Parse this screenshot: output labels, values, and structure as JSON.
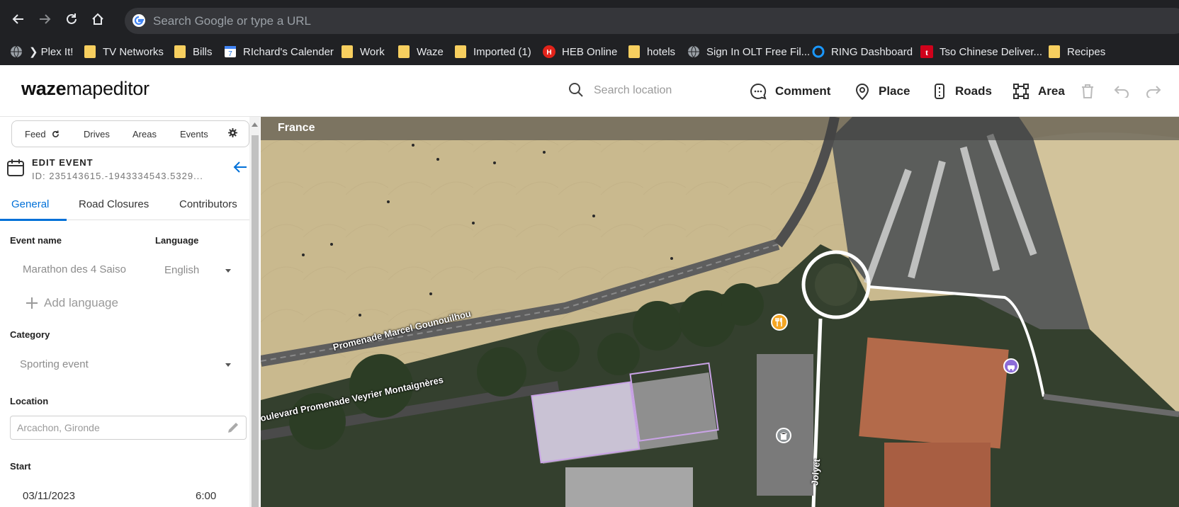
{
  "browser": {
    "omnibox_placeholder": "Search Google or type a URL",
    "bookmarks": [
      {
        "label": "Plex It!",
        "prefix": "❯",
        "icon": "globe-icon"
      },
      {
        "label": "TV Networks",
        "icon": "folder-icon"
      },
      {
        "label": "Bills",
        "icon": "folder-icon"
      },
      {
        "label": "RIchard's Calender",
        "icon": "calendar-icon"
      },
      {
        "label": "Work",
        "icon": "folder-icon"
      },
      {
        "label": "Waze",
        "icon": "folder-icon"
      },
      {
        "label": "Imported (1)",
        "icon": "folder-icon"
      },
      {
        "label": "HEB Online",
        "icon": "heb-icon"
      },
      {
        "label": "hotels",
        "icon": "folder-icon"
      },
      {
        "label": "Sign In OLT Free Fil...",
        "icon": "globe-icon"
      },
      {
        "label": "RING Dashboard",
        "icon": "ring-icon"
      },
      {
        "label": "Tso Chinese Deliver...",
        "icon": "tso-icon"
      },
      {
        "label": "Recipes",
        "icon": "folder-icon"
      }
    ]
  },
  "header": {
    "logo_bold": "waze",
    "logo_rest": "mapeditor",
    "search_placeholder": "Search location",
    "tools": {
      "comment": "Comment",
      "place": "Place",
      "roads": "Roads",
      "area": "Area"
    }
  },
  "sidebar": {
    "tabs": {
      "feed": "Feed",
      "drives": "Drives",
      "areas": "Areas",
      "events": "Events"
    },
    "edit_title": "EDIT EVENT",
    "edit_id": "ID: 235143615.-1943334543.5329...",
    "event_tabs": {
      "general": "General",
      "road_closures": "Road Closures",
      "contributors": "Contributors"
    },
    "fields": {
      "event_name_label": "Event name",
      "event_name_value": "Marathon des 4 Saiso",
      "language_label": "Language",
      "language_value": "English",
      "add_language": "Add language",
      "category_label": "Category",
      "category_value": "Sporting event",
      "location_label": "Location",
      "location_value": "Arcachon, Gironde",
      "start_label": "Start",
      "start_date": "03/11/2023",
      "start_time": "6:00"
    }
  },
  "map": {
    "country": "France",
    "street_labels": {
      "promenade": "Promenade Marcel Gounouilhou",
      "boulevard": "Boulevard Promenade Veyrier Montaignères",
      "jolyet": "Jolyet"
    },
    "colors": {
      "beach": "#c9b98e",
      "water": "#8aa1a4",
      "road": "#6d6d6d",
      "trees": "#2f4029",
      "building_highlight": "#c9a3e6",
      "accent": "#0070d8"
    }
  }
}
